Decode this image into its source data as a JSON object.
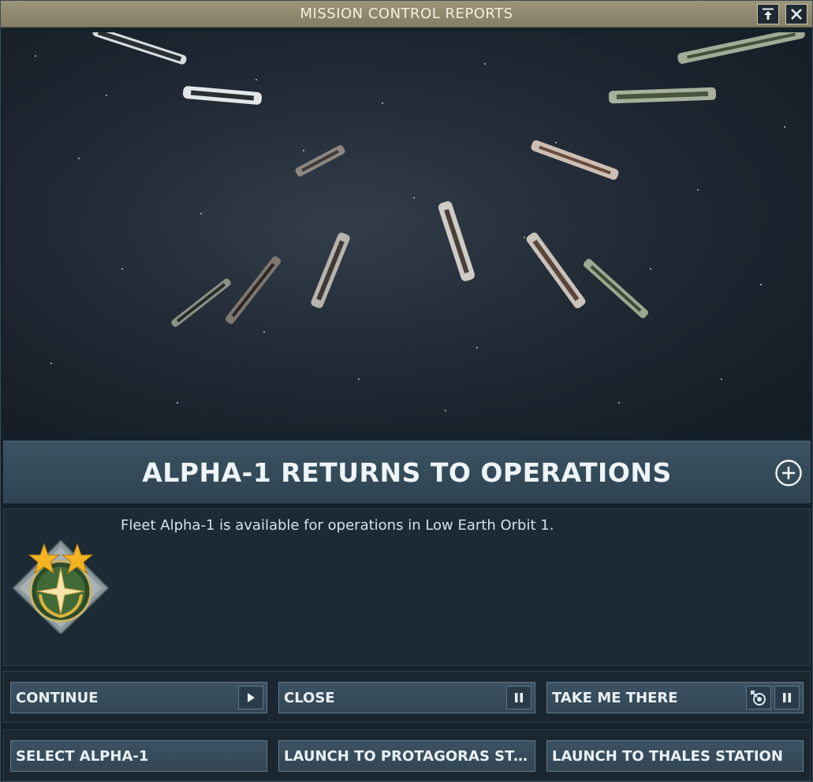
{
  "window": {
    "title": "MISSION CONTROL REPORTS"
  },
  "report": {
    "headline": "ALPHA-1 RETURNS TO OPERATIONS",
    "message": "Fleet Alpha-1 is available for operations in Low Earth Orbit 1."
  },
  "buttons_row1": [
    {
      "label": "CONTINUE",
      "icon": "play-icon"
    },
    {
      "label": "CLOSE",
      "icon": "pause-icon"
    },
    {
      "label": "TAKE ME THERE",
      "icons": [
        "target-icon",
        "pause-icon"
      ]
    }
  ],
  "buttons_row2": [
    {
      "label": "SELECT ALPHA-1"
    },
    {
      "label": "LAUNCH TO PROTAGORAS STATION"
    },
    {
      "label": "LAUNCH TO THALES STATION"
    }
  ],
  "colors": {
    "titlebar": "#8f8a71",
    "panel": "#2e4452",
    "button": "#36495a",
    "star": "#f4b321",
    "badge_green": "#3f6a35"
  }
}
